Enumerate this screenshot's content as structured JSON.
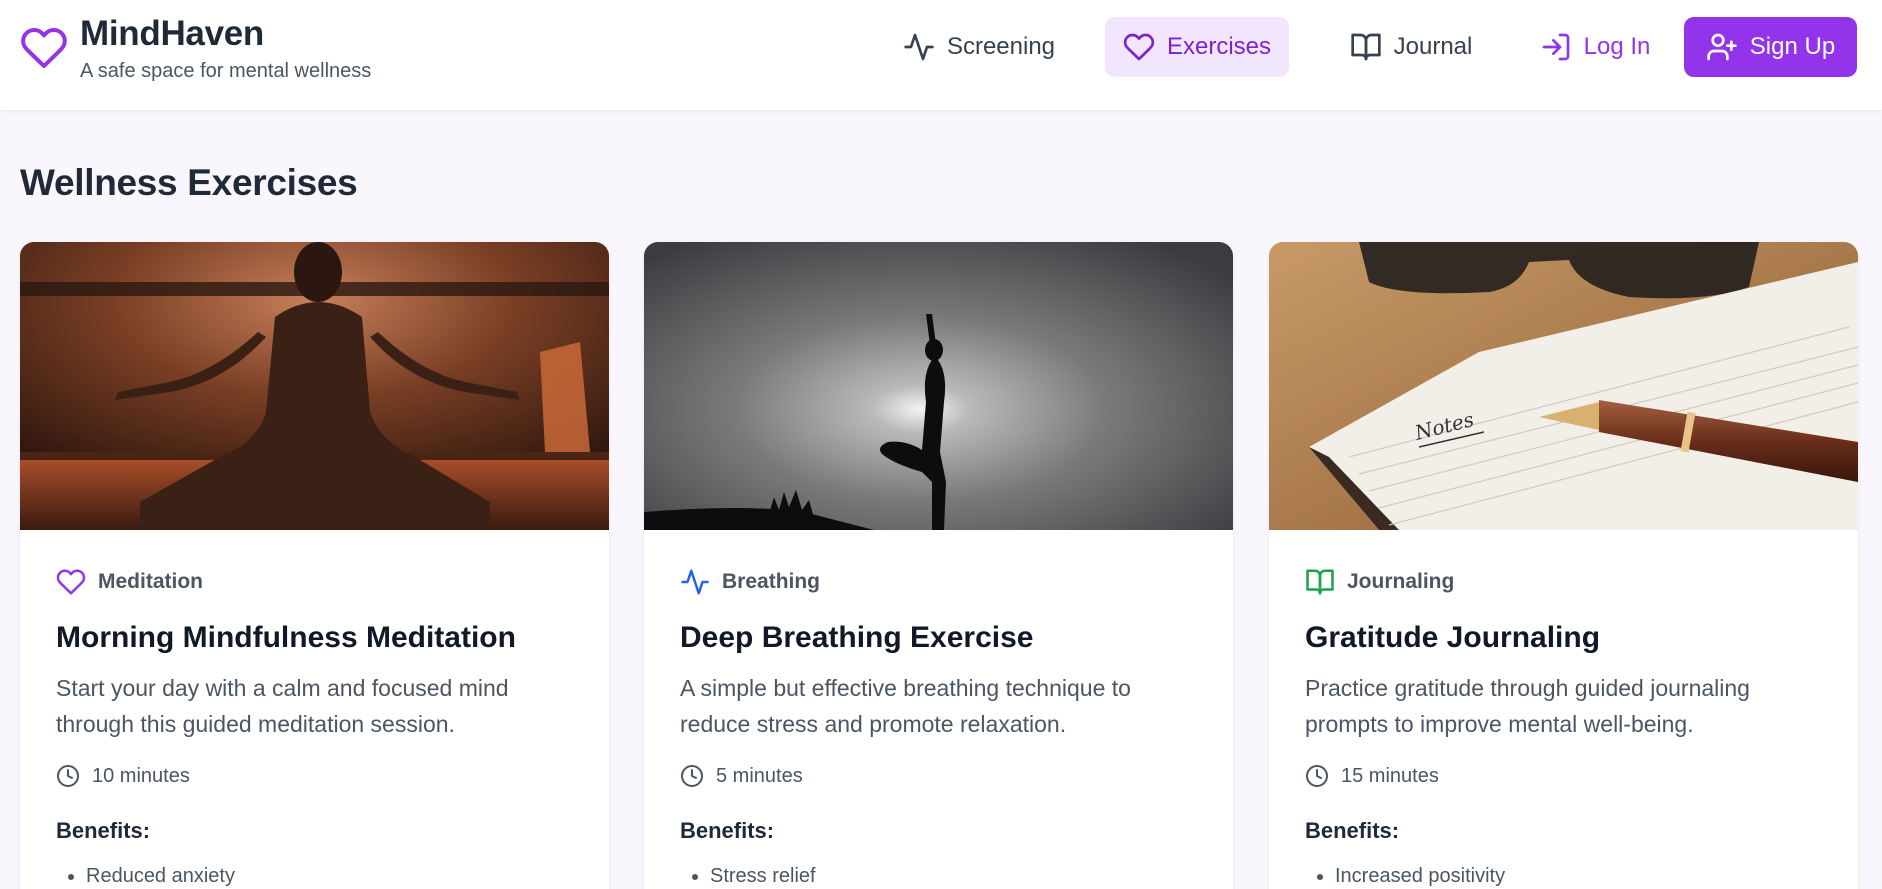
{
  "brand": {
    "title": "MindHaven",
    "subtitle": "A safe space for mental wellness",
    "icon": "heart-icon",
    "color": "#9333ea"
  },
  "nav": {
    "screening": "Screening",
    "exercises": "Exercises",
    "journal": "Journal",
    "login": "Log In",
    "signup": "Sign Up"
  },
  "page": {
    "title": "Wellness Exercises"
  },
  "benefits_heading": "Benefits:",
  "cards": [
    {
      "category": "Meditation",
      "category_icon": "heart-icon",
      "category_color": "#9333ea",
      "title": "Morning Mindfulness Meditation",
      "description": "Start your day with a calm and focused mind through this guided meditation session.",
      "duration": "10 minutes",
      "benefits": [
        "Reduced anxiety"
      ]
    },
    {
      "category": "Breathing",
      "category_icon": "activity-icon",
      "category_color": "#2563eb",
      "title": "Deep Breathing Exercise",
      "description": "A simple but effective breathing technique to reduce stress and promote relaxation.",
      "duration": "5 minutes",
      "benefits": [
        "Stress relief"
      ]
    },
    {
      "category": "Journaling",
      "category_icon": "book-open-icon",
      "category_color": "#16a34a",
      "title": "Gratitude Journaling",
      "description": "Practice gratitude through guided journaling prompts to improve mental well-being.",
      "duration": "15 minutes",
      "benefits": [
        "Increased positivity"
      ],
      "image_text": "Notes"
    }
  ]
}
